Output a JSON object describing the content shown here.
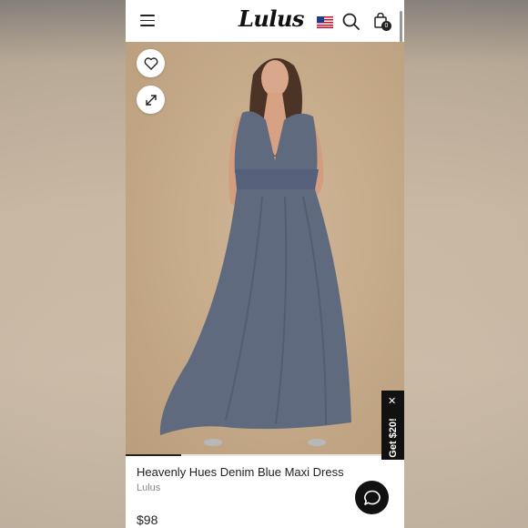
{
  "header": {
    "logo": "Lulus",
    "bag_count": "0"
  },
  "icons": {
    "menu": "hamburger-menu-icon",
    "flag": "us-flag-icon",
    "search": "search-icon",
    "bag": "shopping-bag-icon",
    "favorite": "heart-icon",
    "expand": "expand-icon",
    "close": "close-icon",
    "chat": "chat-bubble-icon"
  },
  "gallery": {
    "progress": 0.2
  },
  "promo": {
    "label": "Get $20!",
    "close": "✕"
  },
  "product": {
    "title": "Heavenly Hues Denim Blue Maxi Dress",
    "brand": "Lulus",
    "price": "$98"
  },
  "colors": {
    "dress": "#5f6a7e",
    "photo_background": "#c7ac8b",
    "promo_background": "#111111"
  }
}
